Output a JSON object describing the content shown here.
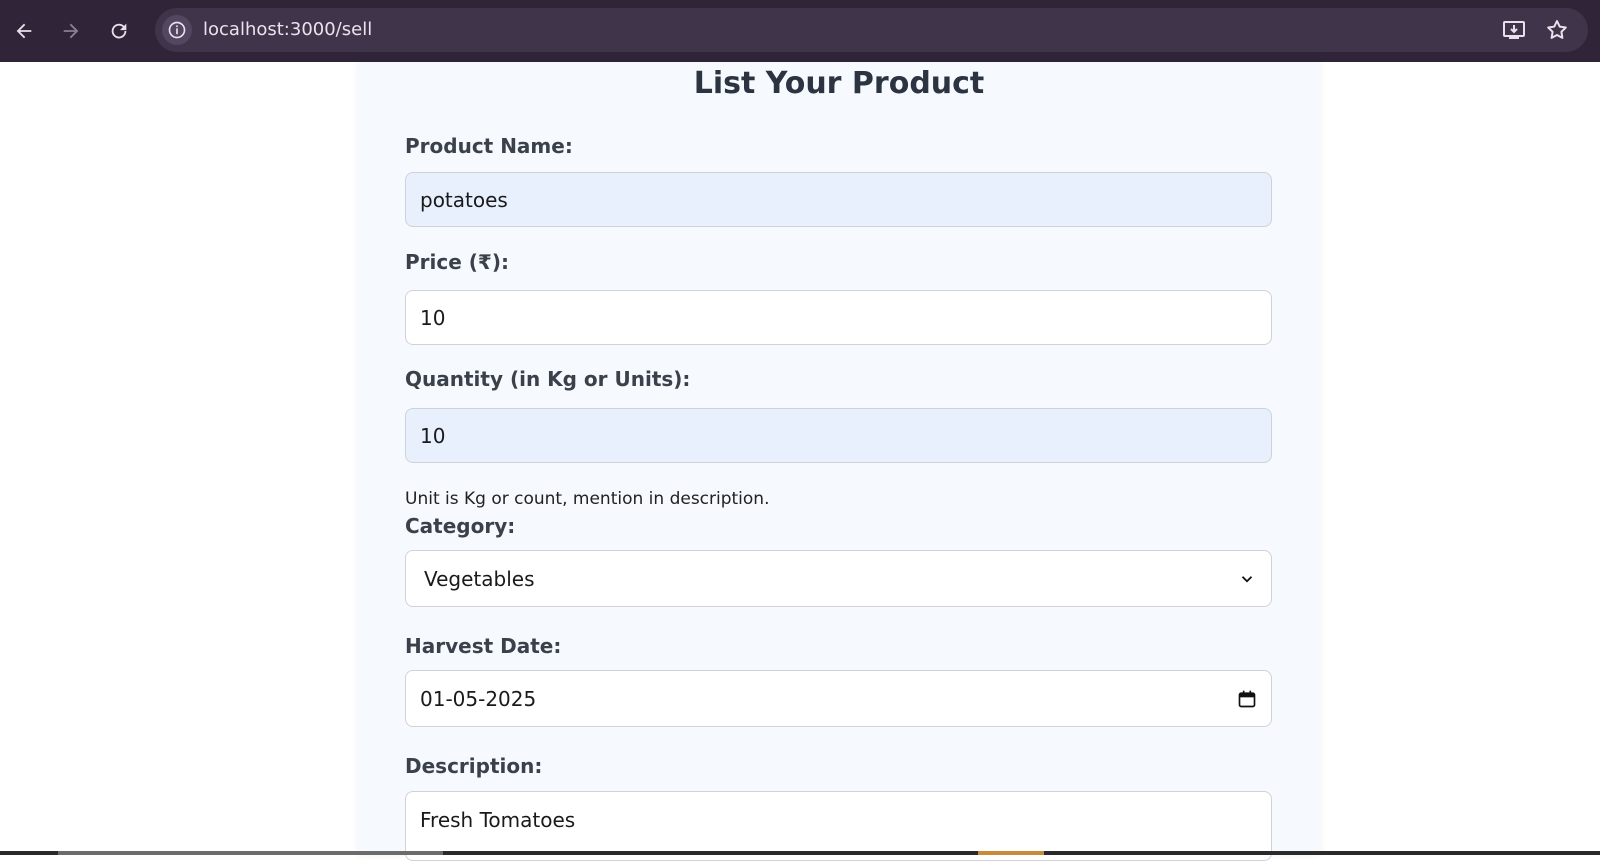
{
  "browser": {
    "url": "localhost:3000/sell",
    "icons": [
      "back-arrow-icon",
      "forward-arrow-icon",
      "reload-icon",
      "info-icon",
      "install-app-icon",
      "bookmark-star-icon"
    ]
  },
  "form": {
    "title": "List Your Product",
    "product_name": {
      "label": "Product Name:",
      "value": "potatoes"
    },
    "price": {
      "label": "Price (₹):",
      "value": "10"
    },
    "quantity": {
      "label": "Quantity (in Kg or Units):",
      "value": "10"
    },
    "hint": "Unit is Kg or count, mention in description.",
    "category": {
      "label": "Category:",
      "value": "Vegetables"
    },
    "harvest_date": {
      "label": "Harvest Date:",
      "value": "01-05-2025"
    },
    "description": {
      "label": "Description:",
      "value": "Fresh Tomatoes"
    }
  },
  "colors": {
    "browser_bar": "#2f2438",
    "omnibox": "#3f3449",
    "card_bg": "#f6f9fd",
    "autofill_bg": "#e8f0fe",
    "label_text": "#3a414b"
  }
}
